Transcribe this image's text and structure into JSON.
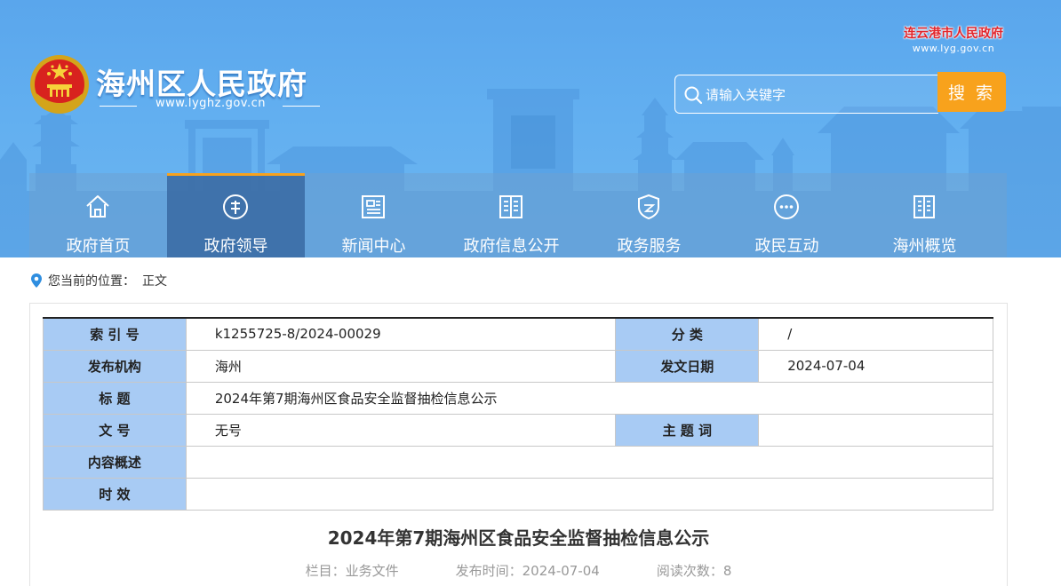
{
  "site": {
    "title": "海州区人民政府",
    "url": "www.lyghz.gov.cn",
    "parent_name": "连云港市人民政府",
    "parent_url": "www.lyg.gov.cn"
  },
  "search": {
    "placeholder": "请输入关键字",
    "button_label": "搜 索"
  },
  "nav": {
    "items": [
      {
        "label": "政府首页",
        "icon": "home-icon"
      },
      {
        "label": "政府领导",
        "icon": "leader-icon",
        "active": true
      },
      {
        "label": "新闻中心",
        "icon": "news-icon"
      },
      {
        "label": "政府信息公开",
        "icon": "info-open-icon"
      },
      {
        "label": "政务服务",
        "icon": "service-shield-icon"
      },
      {
        "label": "政民互动",
        "icon": "chat-icon"
      },
      {
        "label": "海州概览",
        "icon": "overview-icon"
      }
    ]
  },
  "breadcrumb": {
    "prefix": "您当前的位置：",
    "current": "正文"
  },
  "meta_table": {
    "index_label": "索 引 号",
    "index_value": "k1255725-8/2024-00029",
    "category_label": "分 类",
    "category_value": "/",
    "publisher_label": "发布机构",
    "publisher_value": "海州",
    "date_label": "发文日期",
    "date_value": "2024-07-04",
    "title_label": "标 题",
    "title_value": "2024年第7期海州区食品安全监督抽检信息公示",
    "docno_label": "文 号",
    "docno_value": "无号",
    "subject_label": "主 题 词",
    "subject_value": "",
    "summary_label": "内容概述",
    "summary_value": "",
    "validity_label": "时 效",
    "validity_value": ""
  },
  "article": {
    "title": "2024年第7期海州区食品安全监督抽检信息公示",
    "column": "栏目：业务文件",
    "published": "发布时间：2024-07-04",
    "views": "阅读次数：8"
  },
  "colors": {
    "header_blue": "#5aa6ec",
    "accent_orange": "#f8a21c",
    "table_label_blue": "#a8cbf4",
    "parent_site_red": "#e3262c"
  }
}
